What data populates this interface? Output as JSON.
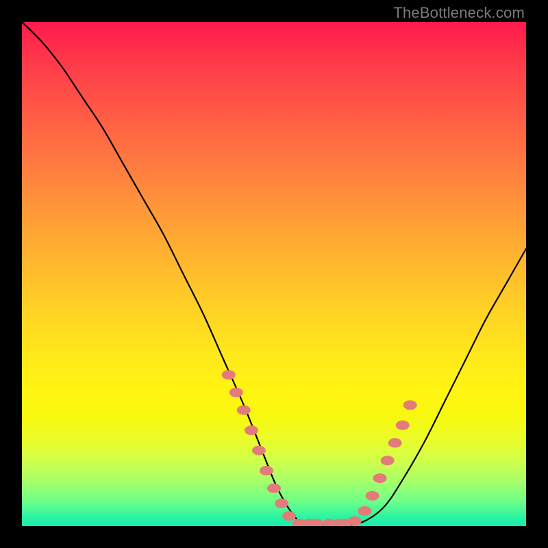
{
  "attribution": "TheBottleneck.com",
  "colors": {
    "background": "#000000",
    "gradient_top": "#ff1a4d",
    "gradient_bottom": "#18eab0",
    "curve": "#000000",
    "markers": "#e37b7b",
    "attribution_text": "#7b7b7b"
  },
  "chart_data": {
    "type": "line",
    "title": "",
    "xlabel": "",
    "ylabel": "",
    "xlim": [
      0,
      100
    ],
    "ylim": [
      0,
      100
    ],
    "series": [
      {
        "name": "bottleneck-curve",
        "x": [
          0,
          4,
          8,
          12,
          16,
          20,
          24,
          28,
          32,
          36,
          40,
          44,
          48,
          50,
          52,
          54,
          56,
          58,
          60,
          62,
          64,
          68,
          72,
          76,
          80,
          84,
          88,
          92,
          96,
          100
        ],
        "y": [
          100,
          96,
          91,
          85,
          79,
          72,
          65,
          58,
          50,
          42,
          33,
          24,
          14,
          9,
          5,
          2,
          0,
          0,
          0,
          0,
          0,
          1,
          4,
          10,
          17,
          25,
          33,
          41,
          48,
          55
        ]
      }
    ],
    "markers": [
      {
        "x": 41.0,
        "y": 30.0
      },
      {
        "x": 42.5,
        "y": 26.5
      },
      {
        "x": 44.0,
        "y": 23.0
      },
      {
        "x": 45.5,
        "y": 19.0
      },
      {
        "x": 47.0,
        "y": 15.0
      },
      {
        "x": 48.5,
        "y": 11.0
      },
      {
        "x": 50.0,
        "y": 7.5
      },
      {
        "x": 51.5,
        "y": 4.5
      },
      {
        "x": 53.0,
        "y": 2.0
      },
      {
        "x": 55.0,
        "y": 0.5
      },
      {
        "x": 57.0,
        "y": 0.5
      },
      {
        "x": 58.5,
        "y": 0.5
      },
      {
        "x": 61.0,
        "y": 0.5
      },
      {
        "x": 63.0,
        "y": 0.5
      },
      {
        "x": 64.0,
        "y": 0.5
      },
      {
        "x": 66.0,
        "y": 1.0
      },
      {
        "x": 68.0,
        "y": 3.0
      },
      {
        "x": 69.5,
        "y": 6.0
      },
      {
        "x": 71.0,
        "y": 9.5
      },
      {
        "x": 72.5,
        "y": 13.0
      },
      {
        "x": 74.0,
        "y": 16.5
      },
      {
        "x": 75.5,
        "y": 20.0
      },
      {
        "x": 77.0,
        "y": 24.0
      }
    ]
  }
}
